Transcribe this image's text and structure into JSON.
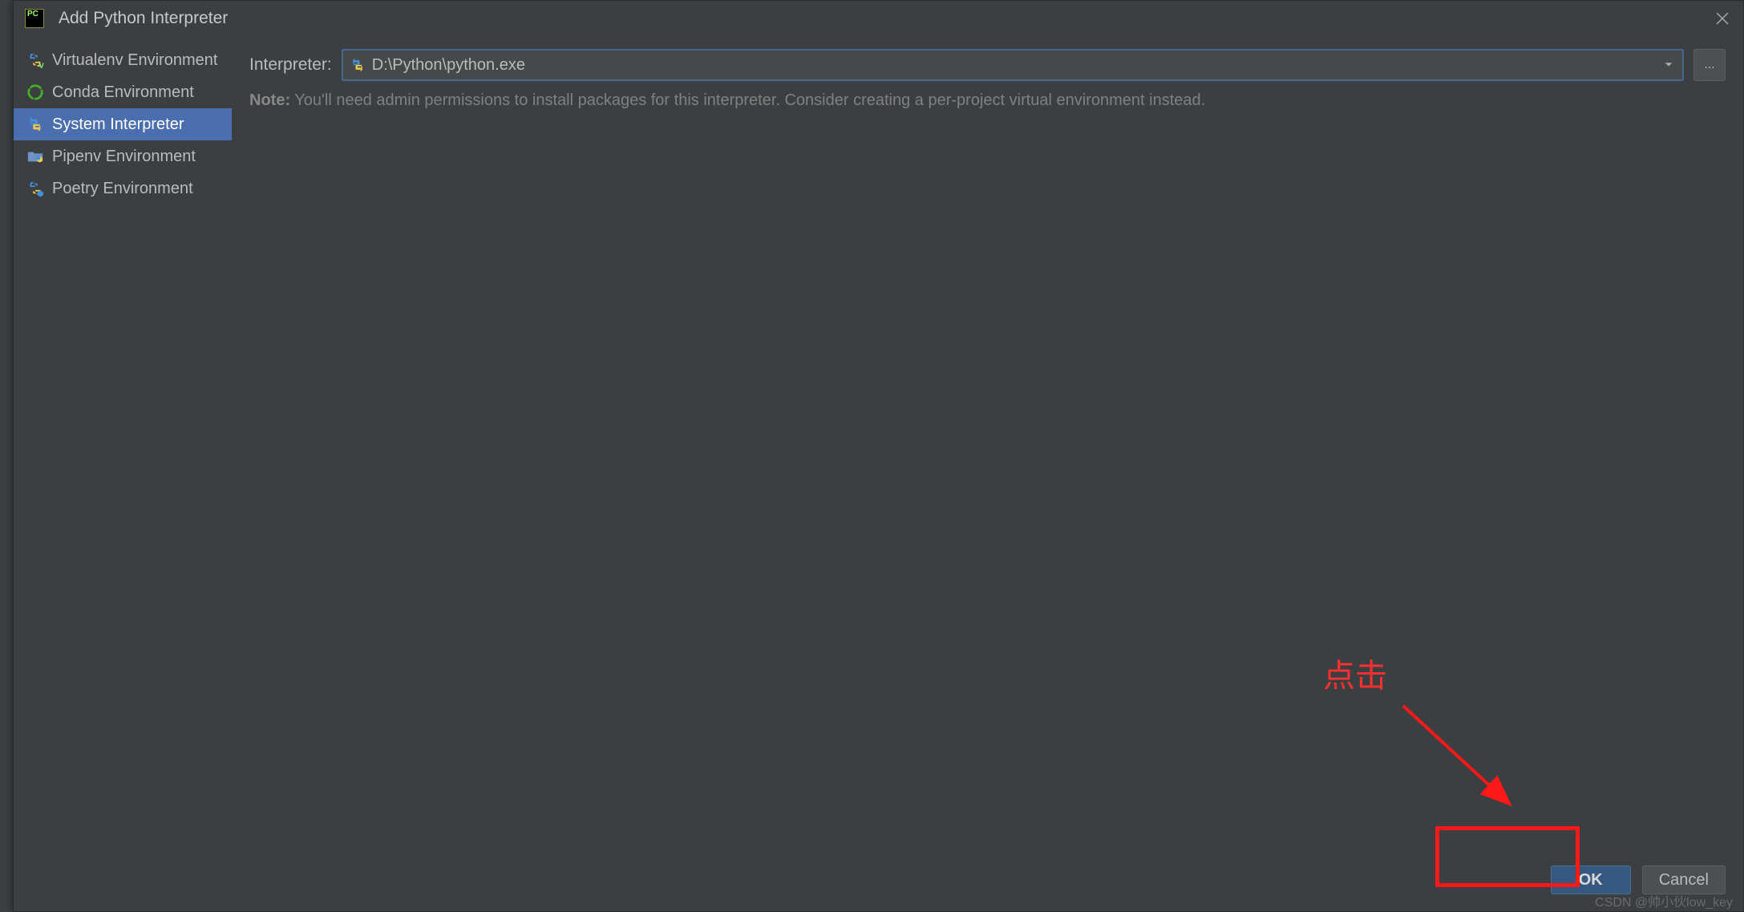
{
  "dialog": {
    "title": "Add Python Interpreter",
    "app_icon_label": "PC"
  },
  "sidebar": {
    "items": [
      {
        "label": "Virtualenv Environment",
        "icon": "python-v",
        "selected": false
      },
      {
        "label": "Conda Environment",
        "icon": "conda",
        "selected": false
      },
      {
        "label": "System Interpreter",
        "icon": "python",
        "selected": true
      },
      {
        "label": "Pipenv Environment",
        "icon": "folder-python",
        "selected": false
      },
      {
        "label": "Poetry Environment",
        "icon": "python-poetry",
        "selected": false
      }
    ]
  },
  "main": {
    "interpreter_label": "Interpreter:",
    "interpreter_path": "D:\\Python\\python.exe",
    "browse_label": "...",
    "note_prefix": "Note:",
    "note_text": " You'll need admin permissions to install packages for this interpreter. Consider creating a per-project virtual environment instead."
  },
  "footer": {
    "ok_label": "OK",
    "cancel_label": "Cancel"
  },
  "annotation": {
    "text": "点击"
  },
  "watermark": "CSDN @帅小伙low_key"
}
